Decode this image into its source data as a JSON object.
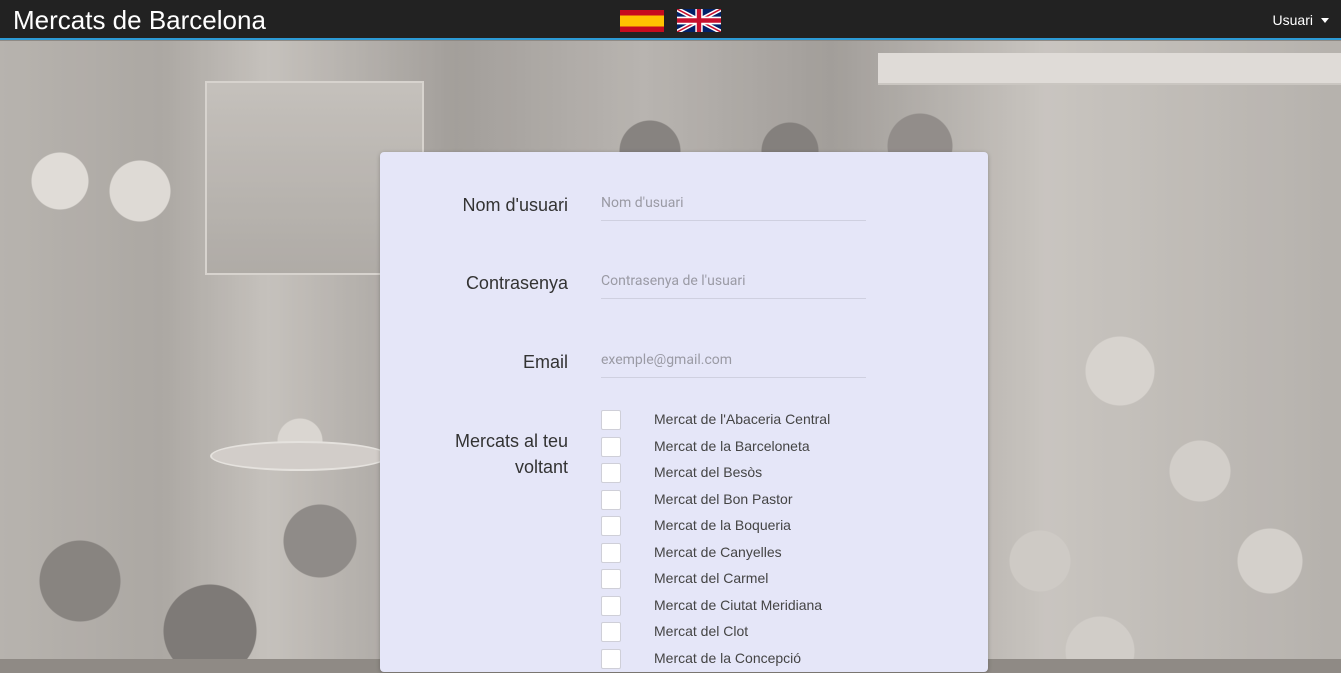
{
  "navbar": {
    "brand": "Mercats de Barcelona",
    "user_menu_label": "Usuari",
    "languages": [
      "spanish-flag",
      "uk-flag"
    ]
  },
  "form": {
    "username": {
      "label": "Nom d'usuari",
      "placeholder": "Nom d'usuari",
      "value": ""
    },
    "password": {
      "label": "Contrasenya",
      "placeholder": "Contrasenya de l'usuari",
      "value": ""
    },
    "email": {
      "label": "Email",
      "placeholder": "exemple@gmail.com",
      "value": ""
    },
    "markets": {
      "label_line1": "Mercats al teu",
      "label_line2": "voltant",
      "items": [
        "Mercat de l'Abaceria Central",
        "Mercat de la Barceloneta",
        "Mercat del Besòs",
        "Mercat del Bon Pastor",
        "Mercat de la Boqueria",
        "Mercat de Canyelles",
        "Mercat del Carmel",
        "Mercat de Ciutat Meridiana",
        "Mercat del Clot",
        "Mercat de la Concepció"
      ]
    }
  },
  "colors": {
    "navbar_bg": "#222222",
    "navbar_accent": "#2d9bd6",
    "card_bg": "#e5e6f8"
  }
}
